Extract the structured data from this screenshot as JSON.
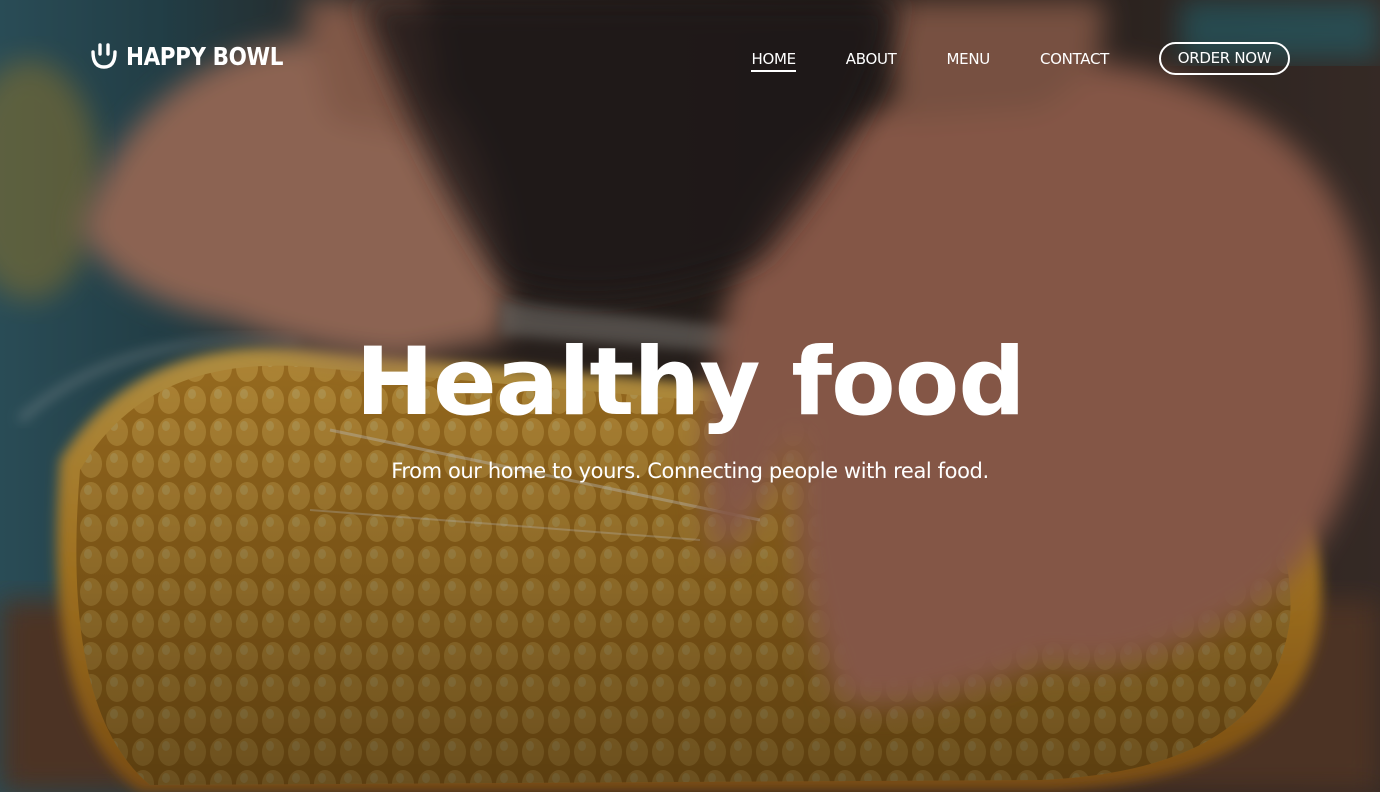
{
  "brand": {
    "name": "HAPPY BOWL",
    "icon": "smile-bowl-icon"
  },
  "nav": {
    "items": [
      {
        "label": "HOME",
        "active": true
      },
      {
        "label": "ABOUT",
        "active": false
      },
      {
        "label": "MENU",
        "active": false
      },
      {
        "label": "CONTACT",
        "active": false
      }
    ],
    "cta_label": "ORDER NOW"
  },
  "hero": {
    "title": "Healthy food",
    "subtitle": "From our home to yours. Connecting people with real food.",
    "background": "hands-cutting-corn-cob-photo"
  },
  "colors": {
    "text": "#ffffff",
    "corn": "#e0a32a",
    "skin": "#c88a70"
  }
}
